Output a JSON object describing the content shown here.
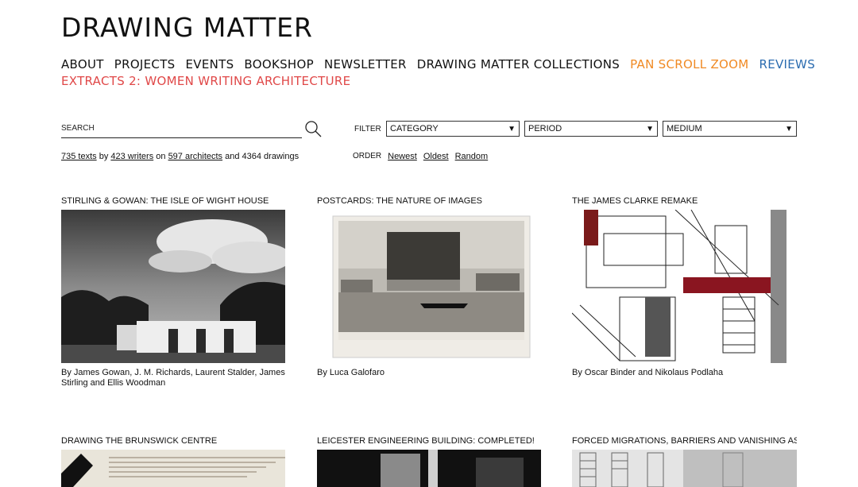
{
  "logo": "DRAWING MATTER",
  "nav": {
    "items": [
      {
        "label": "ABOUT",
        "color": "#111111"
      },
      {
        "label": "PROJECTS",
        "color": "#111111"
      },
      {
        "label": "EVENTS",
        "color": "#111111"
      },
      {
        "label": "BOOKSHOP",
        "color": "#111111"
      },
      {
        "label": "NEWSLETTER",
        "color": "#111111"
      },
      {
        "label": "DRAWING MATTER COLLECTIONS",
        "color": "#111111"
      },
      {
        "label": "PAN SCROLL ZOOM",
        "color": "#f08a24"
      },
      {
        "label": "REVIEWS",
        "color": "#2b6cb0"
      }
    ],
    "extract": {
      "label": "EXTRACTS 2: WOMEN WRITING ARCHITECTURE",
      "color": "#e04848"
    }
  },
  "search": {
    "placeholder": "SEARCH"
  },
  "stats": {
    "texts": "735 texts",
    "by": "by",
    "writers": "423 writers",
    "on": "on",
    "architects": "597 architects",
    "and": "and 4364 drawings"
  },
  "filter": {
    "label": "FILTER",
    "category": "CATEGORY",
    "period": "PERIOD",
    "medium": "MEDIUM"
  },
  "order": {
    "label": "ORDER",
    "options": [
      "Newest",
      "Oldest",
      "Random"
    ]
  },
  "cards": [
    {
      "title": "STIRLING & GOWAN: THE ISLE OF WIGHT HOUSE",
      "authors": "By James Gowan, J. M. Richards, Laurent Stalder, James Stirling and Ellis Woodman"
    },
    {
      "title": "POSTCARDS: THE NATURE OF IMAGES",
      "authors": "By Luca Galofaro"
    },
    {
      "title": "THE JAMES CLARKE REMAKE",
      "authors": "By Oscar Binder and Nikolaus Podlaha"
    },
    {
      "title": "DRAWING THE BRUNSWICK CENTRE",
      "authors": ""
    },
    {
      "title": "LEICESTER ENGINEERING BUILDING: COMPLETED!",
      "authors": ""
    },
    {
      "title": "FORCED MIGRATIONS, BARRIERS AND VANISHING AS",
      "authors": ""
    }
  ]
}
